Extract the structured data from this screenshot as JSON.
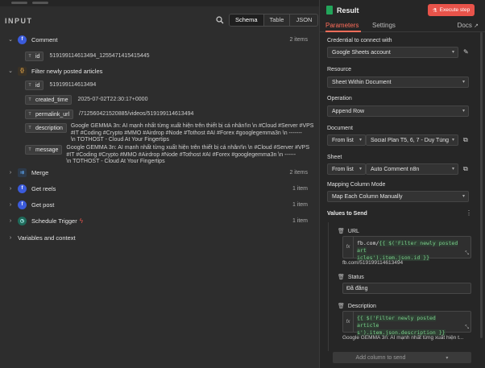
{
  "input_panel": {
    "title": "INPUT",
    "view_tabs": [
      "Schema",
      "Table",
      "JSON"
    ],
    "active_tab": "Schema",
    "comment": {
      "label": "Comment",
      "count": "2 items",
      "fields": [
        {
          "name": "id",
          "value": "519199114613494_1255471415415445"
        }
      ]
    },
    "filter": {
      "label": "Filter newly posted articles",
      "fields": [
        {
          "name": "id",
          "value": "519199114613494"
        },
        {
          "name": "created_time",
          "value": "2025-07-02T22:30:17+0000"
        },
        {
          "name": "permalink_url",
          "value": "/712560421520885/videos/519199114613494"
        },
        {
          "name": "description",
          "line1": "Google GEMMA 3n: AI mạnh nhất từng xuất hiện trên thiết bị cá nhân!\\n \\n #Cloud #Server #VPS",
          "line2": "#IT #Coding #Crypto #MMO #Airdrop #Node #Tothost #AI #Forex #googlegemma3n \\n -------",
          "line3": "\\n TOTHOST - Cloud At Your Fingertips"
        },
        {
          "name": "message",
          "line1": "Google GEMMA 3n: AI mạnh nhất từng xuất hiện trên thiết bị cá nhân!\\n \\n #Cloud #Server #VPS",
          "line2": "#IT #Coding #Crypto #MMO #Airdrop #Node #Tothost #AI #Forex #googlegemma3n \\n ------",
          "line3": "\\n TOTHOST - Cloud At Your Fingertips"
        }
      ]
    },
    "nodes": [
      {
        "label": "Merge",
        "count": "2 items"
      },
      {
        "label": "Get reels",
        "count": "1 item"
      },
      {
        "label": "Get post",
        "count": "1 item"
      },
      {
        "label": "Schedule Trigger",
        "count": "1 item"
      }
    ],
    "variables_label": "Variables and context"
  },
  "result_panel": {
    "title": "Result",
    "execute_label": "Execute step",
    "tabs": [
      "Parameters",
      "Settings"
    ],
    "docs_label": "Docs",
    "credential_label": "Credential to connect with",
    "credential_value": "Google Sheets account",
    "resource_label": "Resource",
    "resource_value": "Sheet Within Document",
    "operation_label": "Operation",
    "operation_value": "Append Row",
    "document_label": "Document",
    "document_mode": "From list",
    "document_value": "Social Plan T5, 6, 7 - Duy Tùng",
    "sheet_label": "Sheet",
    "sheet_mode": "From list",
    "sheet_value": "Auto Comment n8n",
    "mapping_label": "Mapping Column Mode",
    "mapping_value": "Map Each Column Manually",
    "values_label": "Values to Send",
    "url": {
      "label": "URL",
      "expr_prefix": "fb.com/",
      "expr_hl1": "{{ $('Filter newly posted art",
      "expr_hl2": "icles').item.json.id }}",
      "preview": "fb.com/519199114613494"
    },
    "status": {
      "label": "Status",
      "value": "Đã đăng"
    },
    "description": {
      "label": "Description",
      "expr_hl1": "{{ $('Filter newly posted article",
      "expr_hl2": "s').item.json.description }}",
      "preview": "Google GEMMA 3n: AI mạnh nhất từng xuất hiện t..."
    },
    "add_column_label": "Add column to send"
  }
}
